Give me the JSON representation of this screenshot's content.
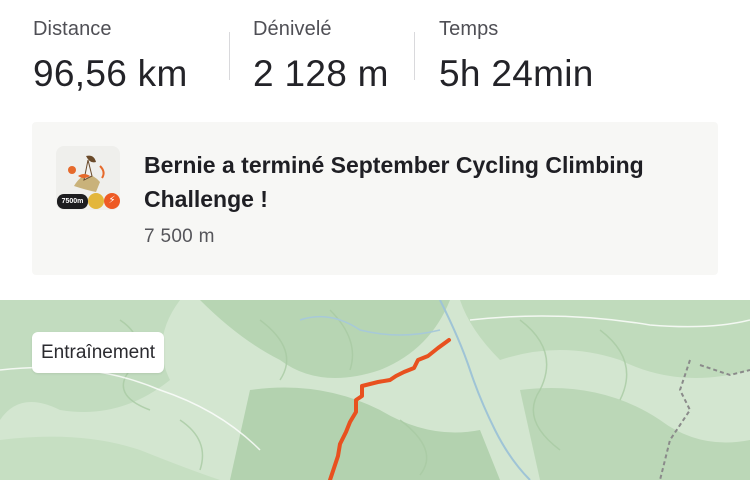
{
  "stats": {
    "distance": {
      "label": "Distance",
      "value": "96,56 km"
    },
    "elevation": {
      "label": "Dénivelé",
      "value": "2 128 m"
    },
    "time": {
      "label": "Temps",
      "value": "5h 24min"
    }
  },
  "achievement": {
    "title": "Bernie a terminé September Cycling Climbing Challenge !",
    "subtitle": "7 500 m",
    "badge_text": "7500m",
    "badge_icons": [
      "climber-illustration-icon",
      "thumbs-up-icon",
      "strava-logo-icon"
    ]
  },
  "map": {
    "tag_label": "Entraînement",
    "route_color": "#e8511f",
    "terrain_color": "#bcd8b8"
  },
  "colors": {
    "card_background": "#f7f7f5",
    "accent": "#fc5200"
  }
}
